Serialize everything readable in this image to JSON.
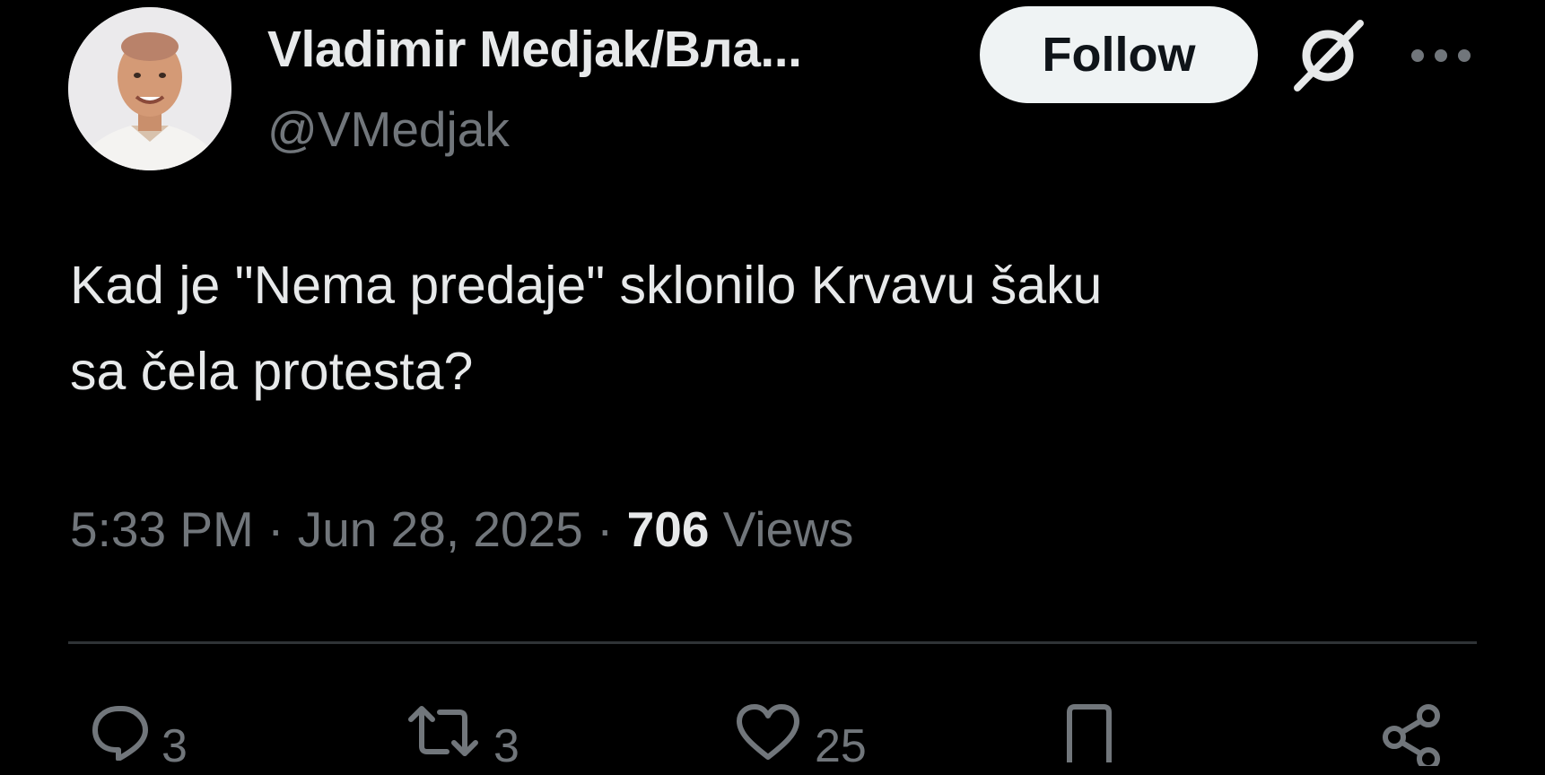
{
  "author": {
    "display_name": "Vladimir Medjak/Вла...",
    "handle": "@VMedjak",
    "avatar_icon": "profile-photo"
  },
  "header": {
    "follow_label": "Follow",
    "grok_icon": "grok-icon",
    "more_icon": "more-dots-icon"
  },
  "tweet": {
    "text_lines": [
      "Kad je \"Nema predaje\" sklonilo Krvavu šaku",
      "sa čela protesta?"
    ],
    "time": "5:33 PM",
    "date": "Jun 28, 2025",
    "separator": "·",
    "views_count": "706",
    "views_label": "Views"
  },
  "actions": {
    "reply_count": "3",
    "repost_count": "3",
    "like_count": "25"
  },
  "colors": {
    "background": "#000000",
    "primary_text": "#e7e9ea",
    "secondary_text": "#71767b",
    "divider": "#2f3336",
    "follow_bg": "#eff3f4"
  }
}
